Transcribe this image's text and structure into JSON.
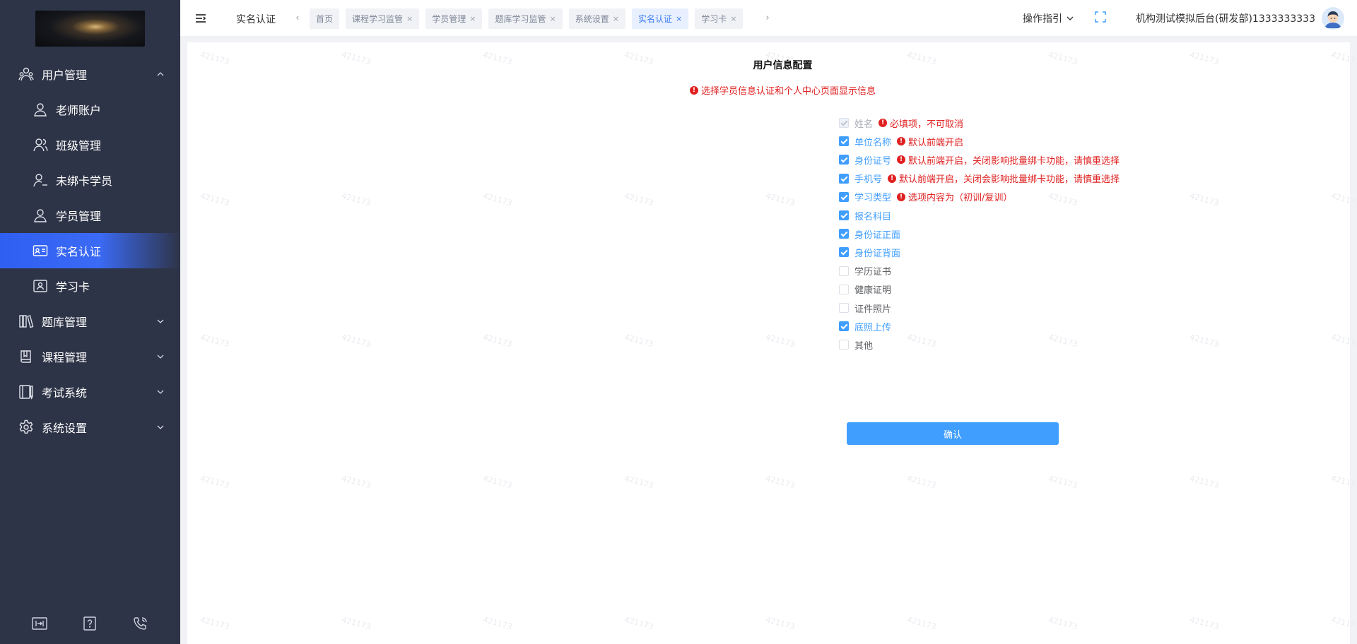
{
  "sidebar": {
    "logo_subtext": "",
    "menu": [
      {
        "label": "用户管理",
        "level": 1,
        "icon": "users-icon",
        "chevron": "up"
      },
      {
        "label": "老师账户",
        "level": 2,
        "icon": "user-icon"
      },
      {
        "label": "班级管理",
        "level": 2,
        "icon": "user-group-icon"
      },
      {
        "label": "未绑卡学员",
        "level": 2,
        "icon": "user-minus-icon"
      },
      {
        "label": "学员管理",
        "level": 2,
        "icon": "user-icon"
      },
      {
        "label": "实名认证",
        "level": 2,
        "icon": "id-card-icon",
        "active": true
      },
      {
        "label": "学习卡",
        "level": 2,
        "icon": "card-icon"
      },
      {
        "label": "题库管理",
        "level": 1,
        "icon": "books-icon",
        "chevron": "down"
      },
      {
        "label": "课程管理",
        "level": 1,
        "icon": "book-icon",
        "chevron": "down"
      },
      {
        "label": "考试系统",
        "level": 1,
        "icon": "exam-icon",
        "chevron": "down"
      },
      {
        "label": "系统设置",
        "level": 1,
        "icon": "gear-icon",
        "chevron": "down"
      }
    ],
    "bottom_icons": [
      "keyboard-icon",
      "help-icon",
      "phone-icon"
    ]
  },
  "topbar": {
    "current_page": "实名认证",
    "tags": [
      {
        "label": "首页",
        "closable": false
      },
      {
        "label": "课程学习监管",
        "closable": true
      },
      {
        "label": "学员管理",
        "closable": true
      },
      {
        "label": "题库学习监管",
        "closable": true
      },
      {
        "label": "系统设置",
        "closable": true
      },
      {
        "label": "实名认证",
        "closable": true,
        "active": true
      },
      {
        "label": "学习卡",
        "closable": true
      }
    ],
    "guide_label": "操作指引",
    "user_label": "机构测试模拟后台(研发部)1333333333"
  },
  "watermark": "421173",
  "form": {
    "title": "用户信息配置",
    "notice": "选择学员信息认证和个人中心页面显示信息",
    "options": [
      {
        "label": "姓名",
        "checked": true,
        "disabled": true,
        "hint": "必填项，不可取消"
      },
      {
        "label": "单位名称",
        "checked": true,
        "hint": "默认前端开启"
      },
      {
        "label": "身份证号",
        "checked": true,
        "hint": "默认前端开启，关闭影响批量绑卡功能，请慎重选择"
      },
      {
        "label": "手机号",
        "checked": true,
        "hint": "默认前端开启，关闭会影响批量绑卡功能，请慎重选择"
      },
      {
        "label": "学习类型",
        "checked": true,
        "hint": "选项内容为（初训/复训）"
      },
      {
        "label": "报名科目",
        "checked": true
      },
      {
        "label": "身份证正面",
        "checked": true
      },
      {
        "label": "身份证背面",
        "checked": true
      },
      {
        "label": "学历证书",
        "checked": false
      },
      {
        "label": "健康证明",
        "checked": false
      },
      {
        "label": "证件照片",
        "checked": false
      },
      {
        "label": "底照上传",
        "checked": true
      },
      {
        "label": "其他",
        "checked": false
      }
    ],
    "confirm_label": "确认"
  },
  "colors": {
    "sidebar_bg": "#2e3447",
    "accent": "#409eff",
    "active_menu": "#2f5ff2",
    "warning": "#e02020"
  }
}
